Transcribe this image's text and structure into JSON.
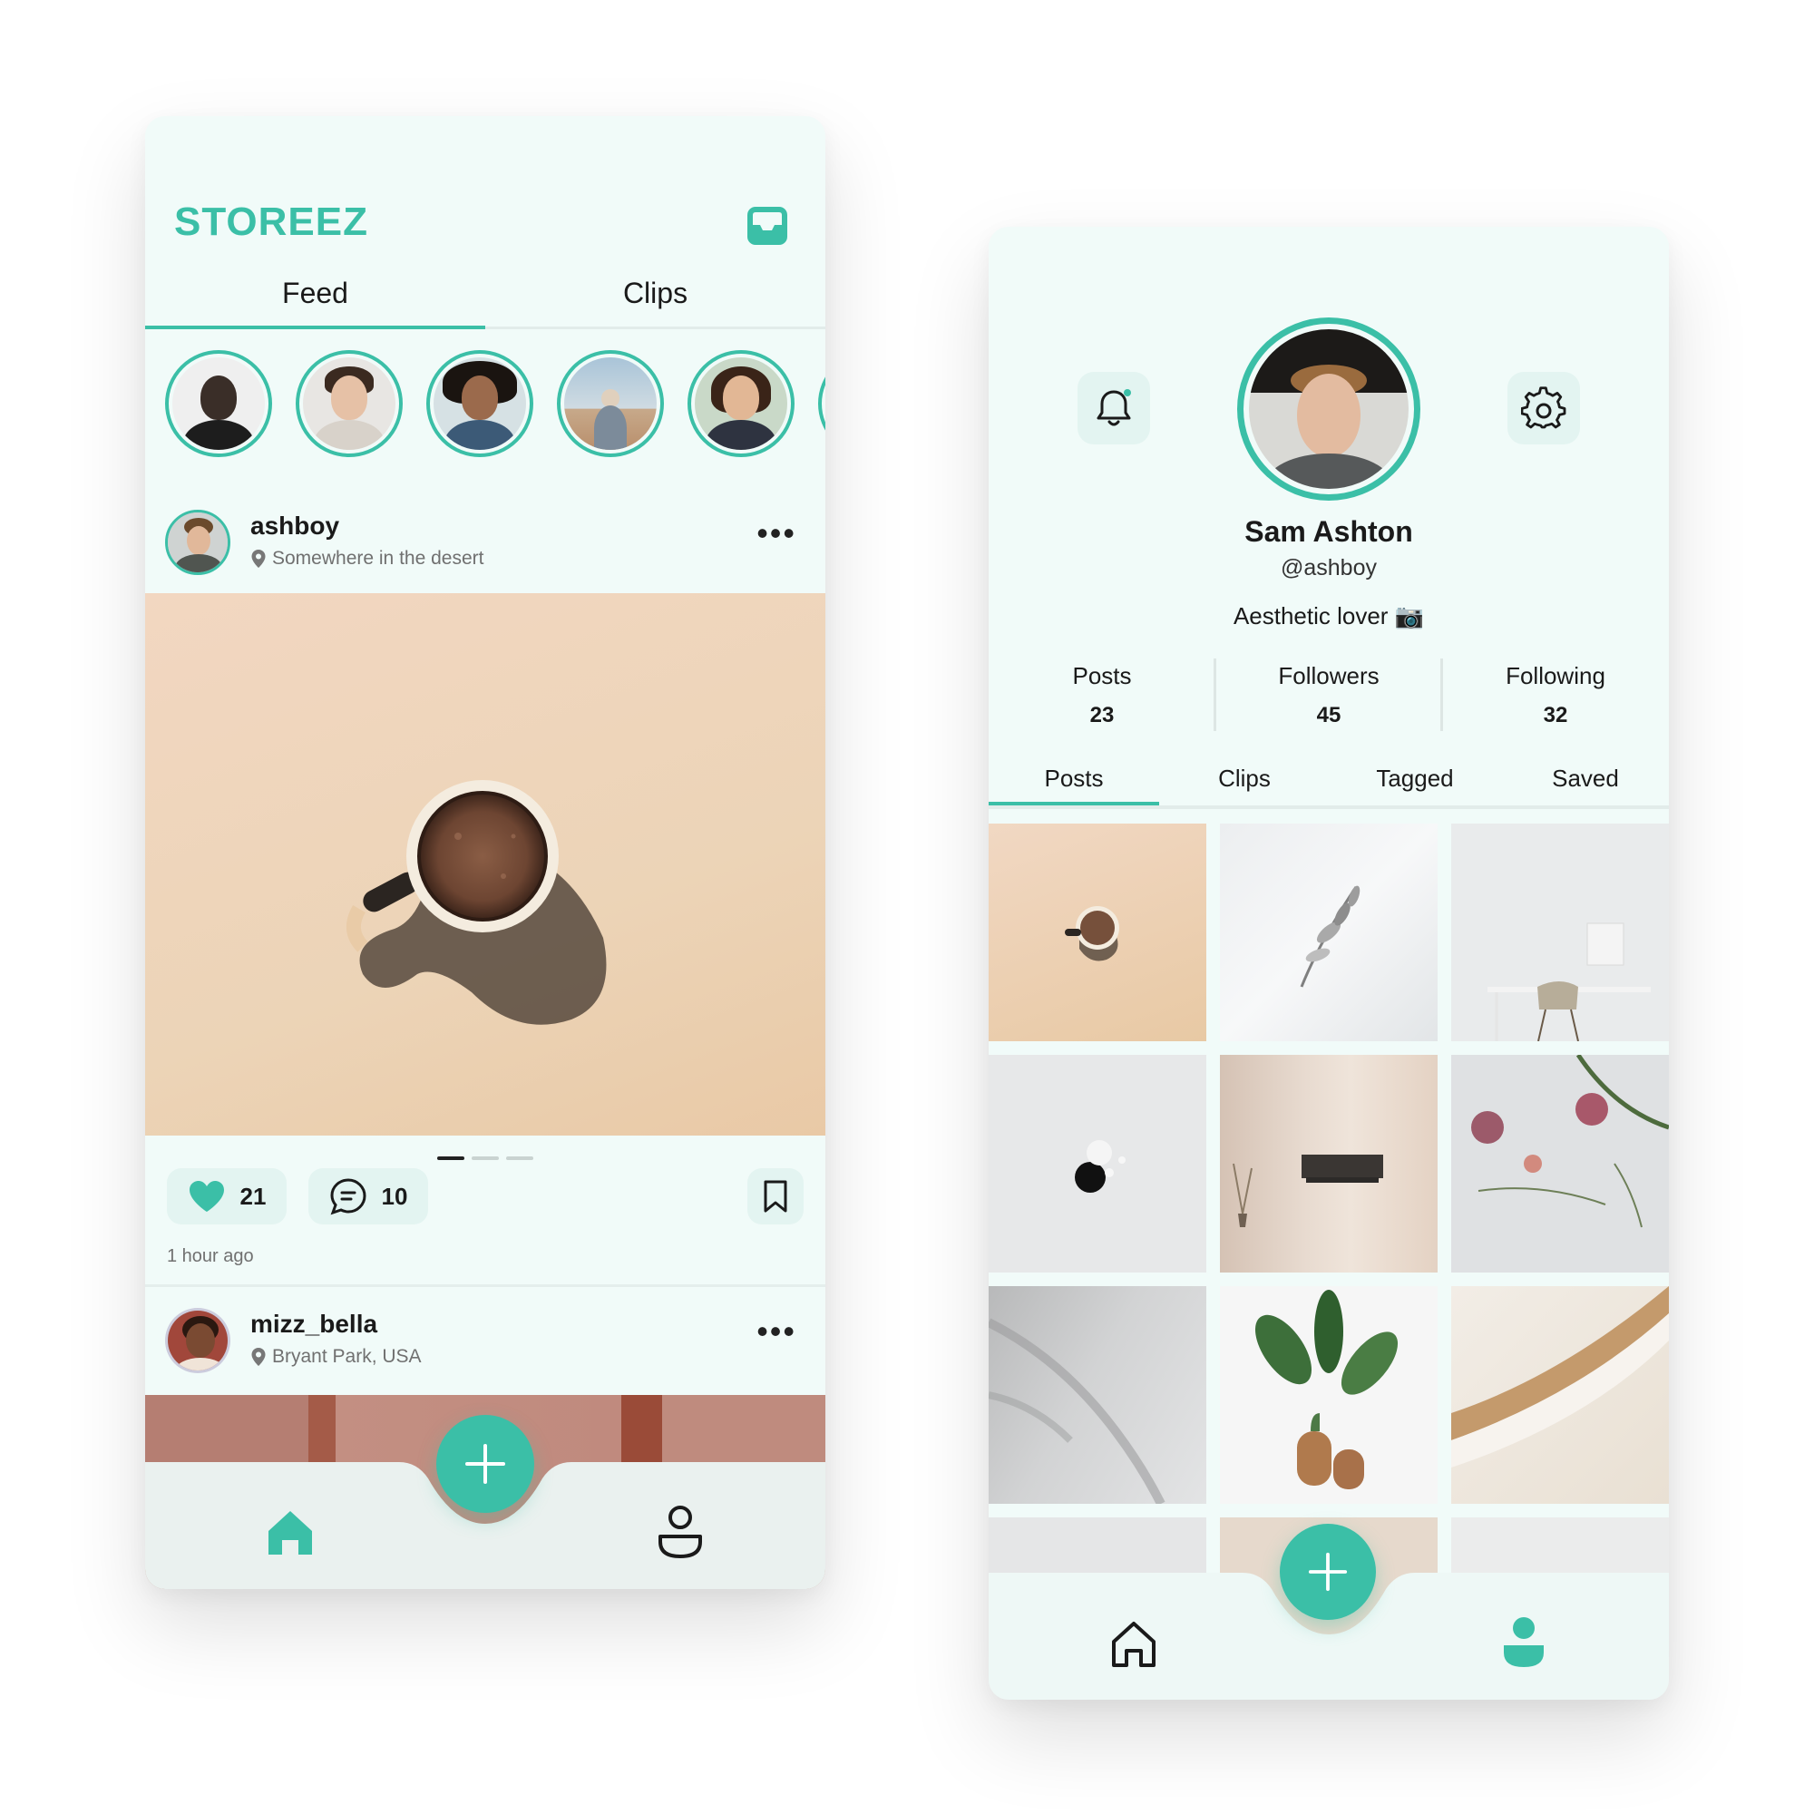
{
  "feed": {
    "brand": "STOREEZ",
    "tabs": [
      {
        "label": "Feed",
        "active": true
      },
      {
        "label": "Clips",
        "active": false
      }
    ],
    "posts": [
      {
        "username": "ashboy",
        "location": "Somewhere in the desert",
        "likes": "21",
        "comments": "10",
        "time": "1 hour ago",
        "slides": 3,
        "active_slide": 1
      },
      {
        "username": "mizz_bella",
        "location": "Bryant Park, USA"
      }
    ],
    "nav": {
      "active": "home"
    }
  },
  "profile": {
    "name": "Sam Ashton",
    "handle": "@ashboy",
    "bio": "Aesthetic lover 📷",
    "stats": [
      {
        "label": "Posts",
        "value": "23"
      },
      {
        "label": "Followers",
        "value": "45"
      },
      {
        "label": "Following",
        "value": "32"
      }
    ],
    "tabs": [
      {
        "label": "Posts",
        "active": true
      },
      {
        "label": "Clips",
        "active": false
      },
      {
        "label": "Tagged",
        "active": false
      },
      {
        "label": "Saved",
        "active": false
      }
    ],
    "nav": {
      "active": "profile"
    }
  },
  "colors": {
    "accent": "#3bbfa7",
    "background": "#f1fbf9",
    "pill": "#e3f4f1"
  }
}
